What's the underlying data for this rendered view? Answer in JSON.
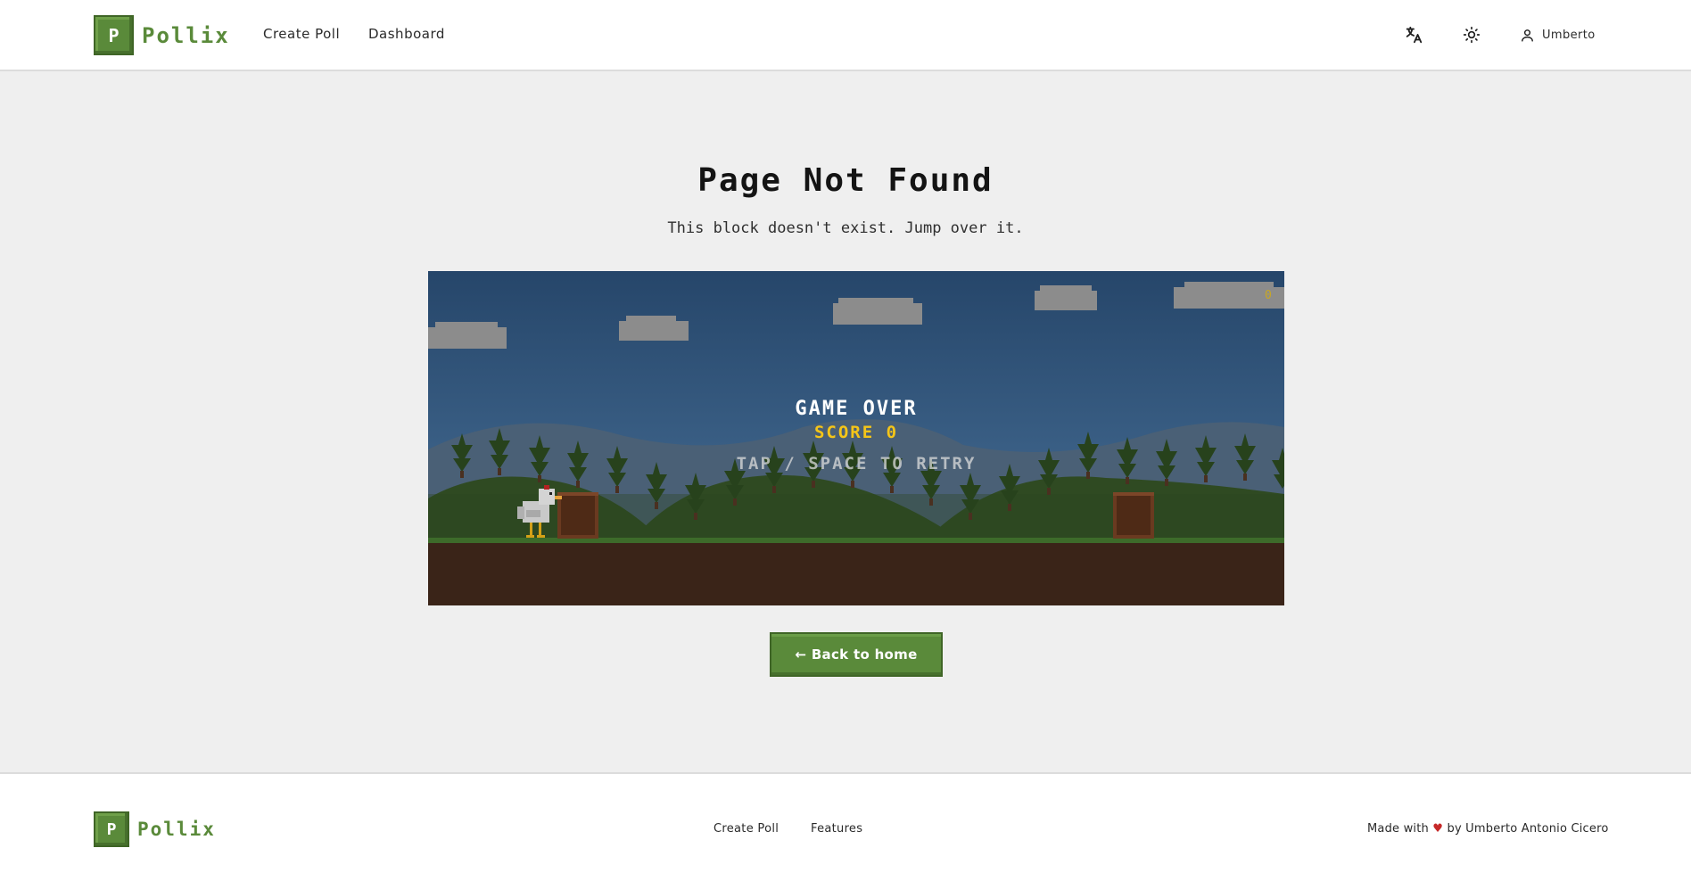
{
  "brand": {
    "logo_letter": "P",
    "name": "Pollix"
  },
  "header": {
    "nav": [
      "Create Poll",
      "Dashboard"
    ],
    "translate_icon": "translate-icon",
    "theme_icon": "sun-icon",
    "user_icon": "user-icon",
    "user_name": "Umberto"
  },
  "main": {
    "title": "Page Not Found",
    "subtitle": "This block doesn't exist. Jump over it.",
    "game": {
      "title": "GAME OVER",
      "score_text": "SCORE 0",
      "hint": "TAP / SPACE TO RETRY",
      "hud_score": "0"
    },
    "back_button": "← Back to home"
  },
  "footer": {
    "links": [
      "Create Poll",
      "Features"
    ],
    "credit_prefix": "Made with",
    "credit_heart": "♥",
    "credit_suffix": "by Umberto Antonio Cicero"
  },
  "colors": {
    "brand_green": "#5a8a3a",
    "page_bg": "#efefef",
    "sky_top": "#26466a",
    "dirt": "#3a2418",
    "score_yellow": "#f5c518",
    "heart_red": "#c62828"
  }
}
